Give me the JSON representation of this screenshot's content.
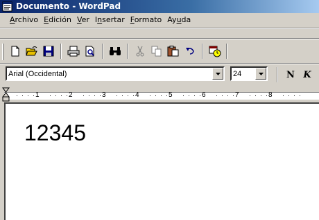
{
  "window": {
    "title": "Documento - WordPad"
  },
  "menu": [
    {
      "label": "Archivo",
      "pre": "",
      "ul": "A",
      "post": "rchivo"
    },
    {
      "label": "Edición",
      "pre": "",
      "ul": "E",
      "post": "dición"
    },
    {
      "label": "Ver",
      "pre": "",
      "ul": "V",
      "post": "er"
    },
    {
      "label": "Insertar",
      "pre": "I",
      "ul": "n",
      "post": "sertar"
    },
    {
      "label": "Formato",
      "pre": "",
      "ul": "F",
      "post": "ormato"
    },
    {
      "label": "Ayuda",
      "pre": "Ay",
      "ul": "u",
      "post": "da"
    }
  ],
  "toolbar": {
    "icons": [
      "new-icon",
      "open-icon",
      "save-icon",
      "print-icon",
      "print-preview-icon",
      "find-icon",
      "cut-icon",
      "copy-icon",
      "paste-icon",
      "undo-icon",
      "insert-datetime-icon"
    ]
  },
  "format": {
    "font": "Arial (Occidental)",
    "size": "24",
    "bold_label": "N",
    "italic_label": "K"
  },
  "ruler": {
    "labels": [
      "1",
      "2",
      "3",
      "4",
      "5",
      "6",
      "7",
      "8"
    ]
  },
  "document": {
    "text": "12345"
  },
  "colors": {
    "title_start": "#0a246a",
    "title_end": "#a6caf0",
    "face": "#d4d0c8"
  }
}
